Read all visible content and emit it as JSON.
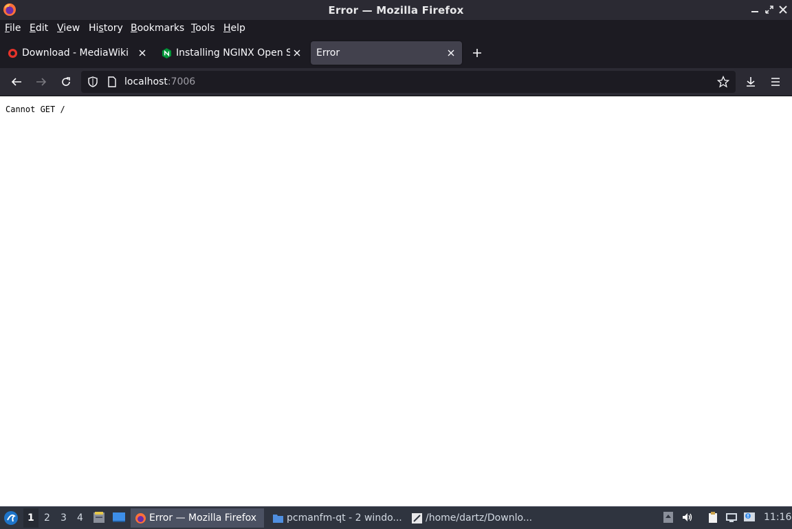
{
  "window": {
    "title": "Error — Mozilla Firefox"
  },
  "menu": {
    "items": [
      {
        "label": "File",
        "accel": "F",
        "rest": "ile"
      },
      {
        "label": "Edit",
        "accel": "E",
        "rest": "dit"
      },
      {
        "label": "View",
        "accel": "V",
        "rest": "iew"
      },
      {
        "label": "History",
        "pre": "Hi",
        "accel": "s",
        "rest": "tory"
      },
      {
        "label": "Bookmarks",
        "accel": "B",
        "rest": "ookmarks"
      },
      {
        "label": "Tools",
        "accel": "T",
        "rest": "ools"
      },
      {
        "label": "Help",
        "accel": "H",
        "rest": "elp"
      }
    ]
  },
  "tabs": [
    {
      "label": "Download - MediaWiki",
      "favicon": "mediawiki-icon",
      "active": false
    },
    {
      "label": "Installing NGINX Open Source",
      "favicon": "nginx-icon",
      "active": false
    },
    {
      "label": "Error",
      "favicon": "",
      "active": true
    }
  ],
  "nav": {
    "url_host": "localhost",
    "url_port": ":7006"
  },
  "content": {
    "text": "Cannot GET /"
  },
  "taskbar": {
    "workspaces": [
      "1",
      "2",
      "3",
      "4"
    ],
    "current_workspace": "1",
    "windows": [
      {
        "label": "Error — Mozilla Firefox",
        "icon": "firefox-icon",
        "active": true
      },
      {
        "label": "pcmanfm-qt - 2 windo...",
        "icon": "folder-icon",
        "active": false
      },
      {
        "label": "/home/dartz/Downlo...",
        "icon": "text-editor-icon",
        "active": false
      }
    ],
    "clock": "11:16"
  },
  "colors": {
    "titlebar": "#2b2a33",
    "tabstrip": "#1c1b22",
    "active_tab": "#42414d",
    "taskbar": "#2f343f"
  }
}
